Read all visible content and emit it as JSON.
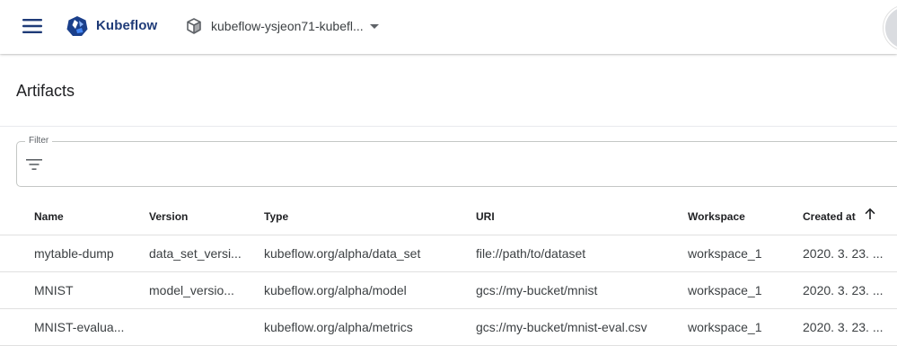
{
  "app": {
    "brand": "Kubeflow",
    "namespace": "kubeflow-ysjeon71-kubefl..."
  },
  "page": {
    "title": "Artifacts"
  },
  "filter": {
    "label": "Filter",
    "value": ""
  },
  "table": {
    "columns": [
      "Name",
      "Version",
      "Type",
      "URI",
      "Workspace",
      "Created at"
    ],
    "sort": {
      "column": "Created at",
      "direction": "ascending"
    },
    "rows": [
      {
        "name": "mytable-dump",
        "version": "data_set_versi...",
        "type": "kubeflow.org/alpha/data_set",
        "uri": "file://path/to/dataset",
        "workspace": "workspace_1",
        "created": "2020. 3. 23. ..."
      },
      {
        "name": "MNIST",
        "version": "model_versio...",
        "type": "kubeflow.org/alpha/model",
        "uri": "gcs://my-bucket/mnist",
        "workspace": "workspace_1",
        "created": "2020. 3. 23. ..."
      },
      {
        "name": "MNIST-evalua...",
        "version": "",
        "type": "kubeflow.org/alpha/metrics",
        "uri": "gcs://my-bucket/mnist-eval.csv",
        "workspace": "workspace_1",
        "created": "2020. 3. 23. ..."
      }
    ]
  },
  "colors": {
    "brand": "#1f3b78",
    "logo_blue": "#4285f4",
    "border": "#e0e0e0"
  },
  "icons": [
    "menu-icon",
    "kubeflow-logo-icon",
    "namespace-cube-icon",
    "dropdown-caret-icon",
    "filter-list-icon",
    "sort-arrow-up-icon",
    "avatar"
  ]
}
